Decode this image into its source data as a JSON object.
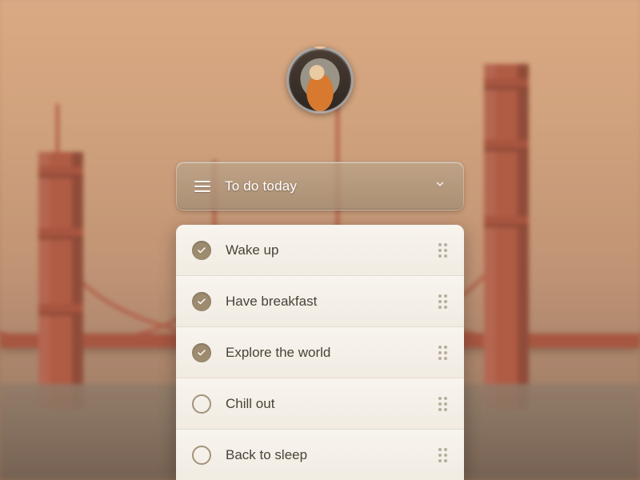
{
  "dropdown": {
    "label": "To do today"
  },
  "tasks": [
    {
      "label": "Wake up",
      "completed": true
    },
    {
      "label": "Have breakfast",
      "completed": true
    },
    {
      "label": "Explore the world",
      "completed": true
    },
    {
      "label": "Chill out",
      "completed": false
    },
    {
      "label": "Back to sleep",
      "completed": false
    }
  ]
}
